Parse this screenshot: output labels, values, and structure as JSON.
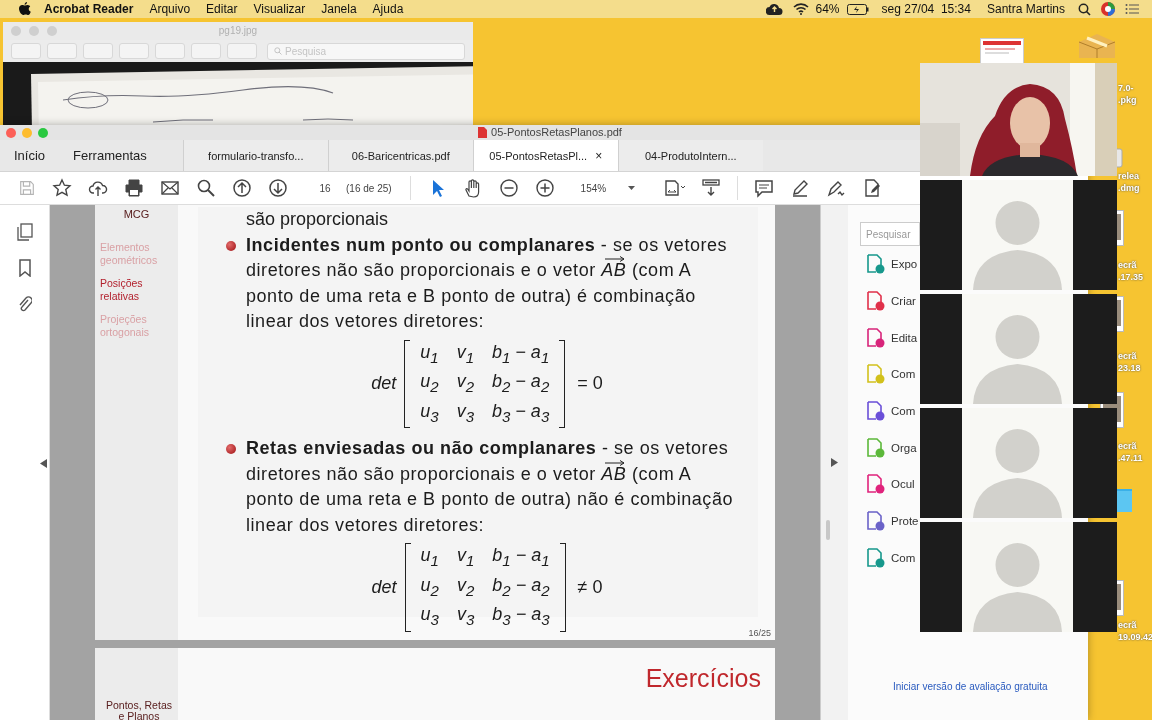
{
  "menubar": {
    "app": "Acrobat Reader",
    "menus": [
      "Arquivo",
      "Editar",
      "Visualizar",
      "Janela",
      "Ajuda"
    ],
    "battery": "64%",
    "datetime": "seg 27/04  15:34",
    "user": "Santra Martins"
  },
  "preview_window": {
    "title": "pg19.jpg",
    "search_placeholder": "Pesquisa"
  },
  "desktop_icons": [
    {
      "kind": "document"
    },
    {
      "kind": "package",
      "lines": [
        "7.0-",
        ".pkg"
      ]
    },
    {
      "kind": "disk",
      "lines": [
        "relea",
        ".dmg"
      ]
    },
    {
      "kind": "screenshot",
      "lines": [
        "ecrã",
        ".17.35"
      ]
    },
    {
      "kind": "screenshot",
      "lines": [
        "ecrã",
        "23.18"
      ]
    },
    {
      "kind": "screenshot",
      "lines": [
        "ecrã",
        ".47.11"
      ]
    },
    {
      "kind": "folder"
    },
    {
      "kind": "screenshot",
      "lines": [
        "ecrã",
        "19.09.42"
      ]
    }
  ],
  "acrobat": {
    "title": "05-PontosRetasPlanos.pdf",
    "nav": [
      "Início",
      "Ferramentas"
    ],
    "tabs": [
      {
        "label": "formulario-transfo...",
        "selected": false
      },
      {
        "label": "06-Baricentricas.pdf",
        "selected": false
      },
      {
        "label": "05-PontosRetasPl...",
        "selected": true,
        "close": "×"
      },
      {
        "label": "04-ProdutoIntern...",
        "selected": false
      }
    ],
    "toolbar": {
      "page": "16",
      "page_count": "(16 de 25)",
      "zoom": "154%"
    },
    "slide": {
      "header": "MCG",
      "nav": [
        {
          "label": "Elementos geométricos",
          "selected": false
        },
        {
          "label": "Posições relativas",
          "selected": true
        },
        {
          "label": "Projeções ortogonais",
          "selected": false
        }
      ],
      "top_line": "são proporcionais",
      "items": [
        {
          "title": "Incidentes num ponto ou complanares",
          "text_before": " - se os vetores diretores não são proporcionais e o vetor ",
          "vector": "AB",
          "text_after": " (com A ponto de uma reta e B ponto de outra) é combinação linear dos vetores diretores:",
          "formula": {
            "operator": "det",
            "rows": [
              [
                "u$_{1}$",
                "v$_{1}$",
                "b$_{1}$ − a$_{1}$"
              ],
              [
                "u$_{2}$",
                "v$_{2}$",
                "b$_{2}$ − a$_{2}$"
              ],
              [
                "u$_{3}$",
                "v$_{3}$",
                "b$_{3}$ − a$_{3}$"
              ]
            ],
            "relation": "= 0"
          }
        },
        {
          "title": "Retas enviesadas ou não complanares",
          "text_before": " - se os vetores diretores não são proporcionais e o vetor ",
          "vector": "AB",
          "text_after": " (com A ponto de uma reta e B ponto de outra) não é combinação linear dos vetores diretores:",
          "formula": {
            "operator": "det",
            "rows": [
              [
                "u$_{1}$",
                "v$_{1}$",
                "b$_{1}$ − a$_{1}$"
              ],
              [
                "u$_{2}$",
                "v$_{2}$",
                "b$_{2}$ − a$_{2}$"
              ],
              [
                "u$_{3}$",
                "v$_{3}$",
                "b$_{3}$ − a$_{3}$"
              ]
            ],
            "relation": "≠ 0"
          }
        }
      ],
      "page_label": "16/25"
    },
    "next_slide": {
      "title": "Exercícios",
      "nav_lines": [
        "Pontos, Retas",
        "e Planos"
      ]
    },
    "tools_panel": {
      "search_placeholder": "Pesquisar",
      "tools": [
        {
          "label": "Expo",
          "color": "#17988c"
        },
        {
          "label": "Criar",
          "color": "#e0304a"
        },
        {
          "label": "Edita",
          "color": "#d8247a"
        },
        {
          "label": "Com",
          "color": "#d2c11c"
        },
        {
          "label": "Com",
          "color": "#6a4fd8"
        },
        {
          "label": "Orga",
          "color": "#5cb83a"
        },
        {
          "label": "Ocul",
          "color": "#e0237c"
        },
        {
          "label": "Prote",
          "color": "#6a62c8"
        },
        {
          "label": "Com",
          "color": "#17988c"
        }
      ],
      "trial_link": "Iniciar versão de avaliação gratuita"
    }
  },
  "video_panel": {
    "tiles": [
      {
        "kind": "camera"
      },
      {
        "kind": "avatar"
      },
      {
        "kind": "avatar"
      },
      {
        "kind": "avatar"
      },
      {
        "kind": "avatar"
      }
    ]
  }
}
